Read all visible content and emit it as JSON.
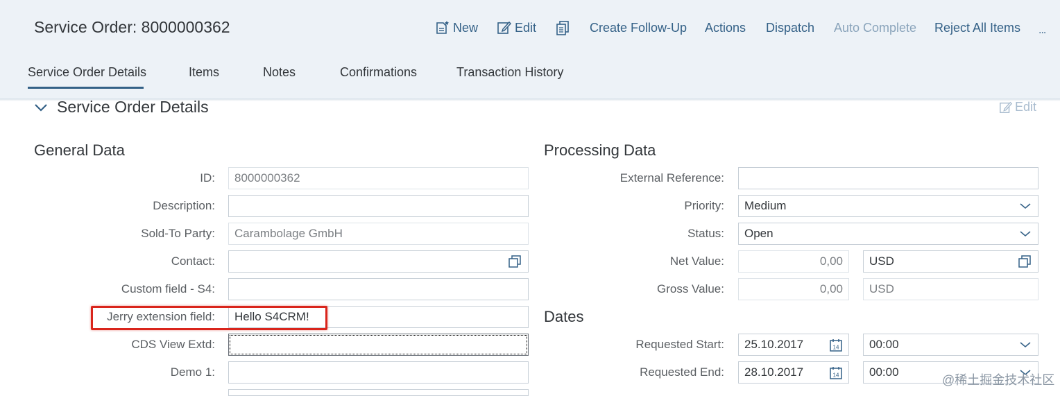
{
  "header": {
    "title": "Service Order: 8000000362",
    "toolbar": {
      "new_label": "New",
      "edit_label": "Edit",
      "create_follow_up_label": "Create Follow-Up",
      "actions_label": "Actions",
      "dispatch_label": "Dispatch",
      "auto_complete_label": "Auto Complete",
      "reject_all_label": "Reject All Items",
      "overflow_label": "..."
    },
    "tabs": [
      {
        "label": "Service Order Details",
        "active": true
      },
      {
        "label": "Items"
      },
      {
        "label": "Notes"
      },
      {
        "label": "Confirmations"
      },
      {
        "label": "Transaction History"
      }
    ]
  },
  "section": {
    "title": "Service Order Details",
    "edit_label": "Edit"
  },
  "general": {
    "title": "General Data",
    "fields": [
      {
        "label": "ID:",
        "value": "8000000362"
      },
      {
        "label": "Description:",
        "value": ""
      },
      {
        "label": "Sold-To Party:",
        "value": "Carambolage GmbH"
      },
      {
        "label": "Contact:",
        "value": ""
      },
      {
        "label": "Custom field - S4:",
        "value": ""
      },
      {
        "label": "Jerry extension field:",
        "value": "Hello S4CRM!"
      },
      {
        "label": "CDS View Extd:",
        "value": ""
      },
      {
        "label": "Demo 1:",
        "value": ""
      }
    ]
  },
  "processing": {
    "title": "Processing Data",
    "external_reference": {
      "label": "External Reference:",
      "value": ""
    },
    "priority": {
      "label": "Priority:",
      "value": "Medium"
    },
    "status": {
      "label": "Status:",
      "value": "Open"
    },
    "net_value": {
      "label": "Net Value:",
      "value": "0,00",
      "currency": "USD"
    },
    "gross_value": {
      "label": "Gross Value:",
      "value": "0,00",
      "currency": "USD"
    }
  },
  "dates": {
    "title": "Dates",
    "requested_start": {
      "label": "Requested Start:",
      "date": "25.10.2017",
      "time": "00:00"
    },
    "requested_end": {
      "label": "Requested End:",
      "date": "28.10.2017",
      "time": "00:00"
    }
  },
  "icons": {
    "calendar_day": "14"
  },
  "colors": {
    "accent": "#346187",
    "header_bg": "#edf2f7",
    "highlight": "#d9251c"
  },
  "watermark": "@稀土掘金技术社区"
}
